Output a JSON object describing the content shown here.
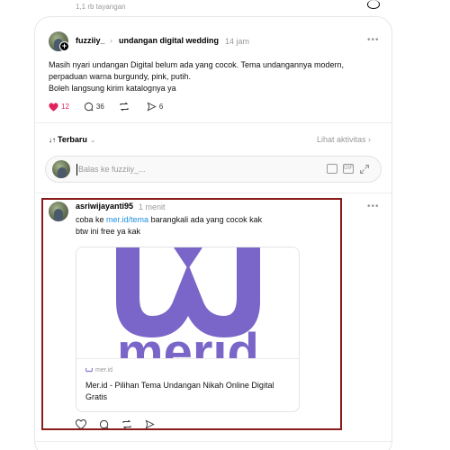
{
  "top": {
    "meta": "1,1 rb tayangan"
  },
  "post": {
    "author": "fuzziiy_",
    "community": "undangan digital wedding",
    "time": "14 jam",
    "lines": [
      "Masih nyari undangan Digital belum ada yang cocok. Tema undangannya modern,",
      "perpaduan warna burgundy, pink, putih.",
      "Boleh langsung kirim katalognya ya"
    ],
    "likes": "12",
    "comments": "36",
    "shares": "6"
  },
  "sort": {
    "label": "Terbaru",
    "activity": "Lihat aktivitas"
  },
  "reply_box": {
    "placeholder": "Balas ke fuzziiy_..."
  },
  "reply": {
    "author": "asriwijayanti95",
    "time": "1 menit",
    "text_before": "coba ke ",
    "link": "mer.id/tema",
    "text_after": " barangkali ada yang cocok kak",
    "line2": "btw ini free ya kak",
    "card": {
      "logo_text": "merid",
      "domain": "mer.id",
      "title": "Mer.id - Pilihan Tema Undangan Nikah Online Digital Gratis"
    }
  },
  "colors": {
    "accent_link": "#1d8fe0",
    "like": "#e0245e",
    "highlight": "#8b1a1a",
    "brand": "#7a66c9"
  }
}
